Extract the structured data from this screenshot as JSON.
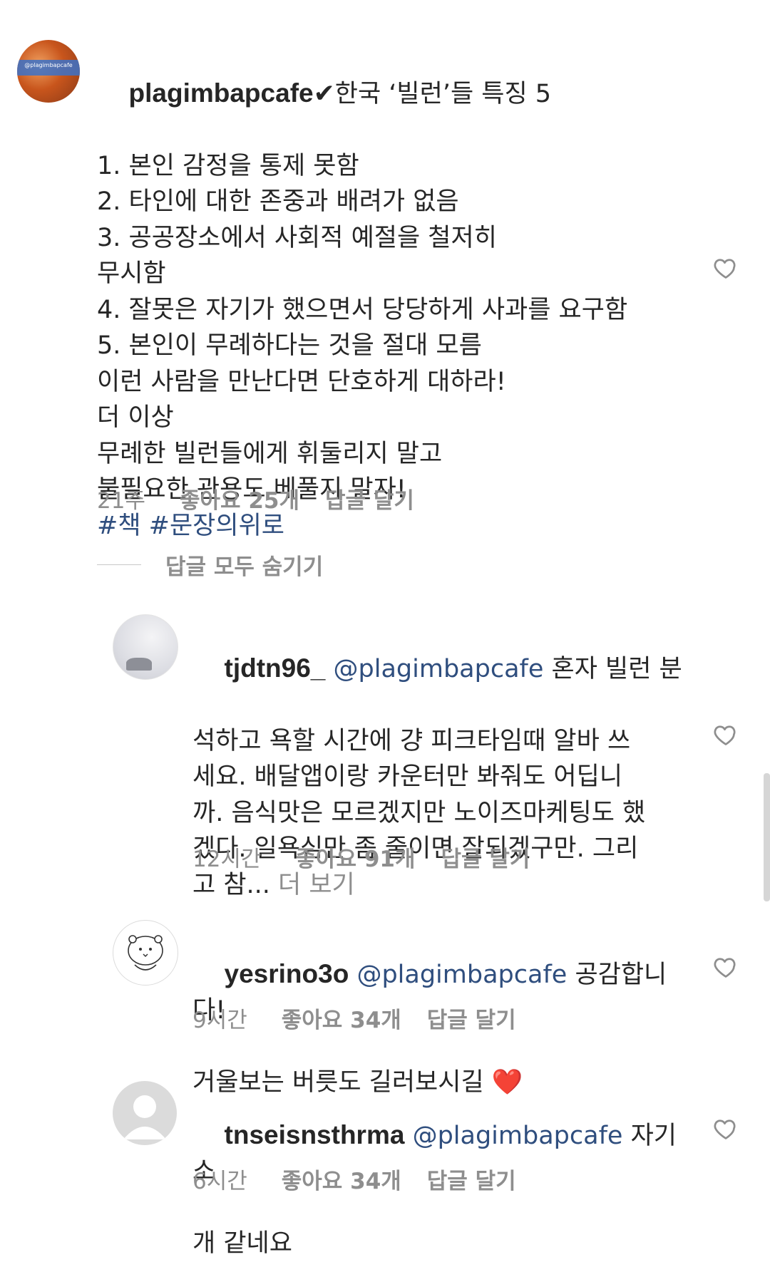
{
  "main_comment": {
    "username": "plagimbapcafe",
    "verified_glyph": "✔",
    "title": "한국 ‘빌런’들 특징 5",
    "lines": [
      "1. 본인 감정을 통제 못함",
      "2. 타인에 대한 존중과 배려가 없음",
      "3. 공공장소에서 사회적 예절을 철저히",
      "무시함",
      "4. 잘못은 자기가 했으면서 당당하게 사과를 요구함",
      "5. 본인이 무례하다는 것을 절대 모름",
      "이런 사람을 만난다면 단호하게 대하라!",
      "더 이상",
      "무례한 빌런들에게 휘둘리지 말고",
      "불필요한 관용도 베풀지 말자!"
    ],
    "hashtags": "#책 #문장의위로",
    "time": "21주",
    "likes": "좋아요 25개",
    "reply": "답글 달기",
    "avatar_text": "@plagimbapcafe"
  },
  "hide_replies_label": "답글 모두 숨기기",
  "replies": [
    {
      "username": "tjdtn96_",
      "mention": "@plagimbapcafe",
      "line1_rest": " 혼자 빌런 분",
      "lines": [
        "석하고 욕할 시간에 걍 피크타임때 알바 쓰",
        "세요. 배달앱이랑 카운터만 봐줘도 어딥니",
        "까. 음식맛은 모르겠지만 노이즈마케팅도 했",
        "겠다. 일욕심만 좀 줄이면 잘되겠구만. 그리"
      ],
      "last_line": "고 참...",
      "more": " 더 보기",
      "time": "12시간",
      "likes": "좋아요 91개",
      "reply": "답글 달기"
    },
    {
      "username": "yesrino3o",
      "mention": "@plagimbapcafe",
      "line1_rest": " 공감합니다!",
      "line2": "거울보는 버릇도 길러보시길 ",
      "emoji": "❤️",
      "time": "9시간",
      "likes": "좋아요 34개",
      "reply": "답글 달기"
    },
    {
      "username": "tnseisnsthrma",
      "mention": "@plagimbapcafe",
      "line1_rest": " 자기소",
      "line2": "개 같네요",
      "time": "6시간",
      "likes": "좋아요 34개",
      "reply": "답글 달기"
    }
  ],
  "colors": {
    "text": "#262626",
    "muted": "#8e8e8e",
    "link": "#2f4e7e",
    "heart_red": "#ed4956"
  }
}
